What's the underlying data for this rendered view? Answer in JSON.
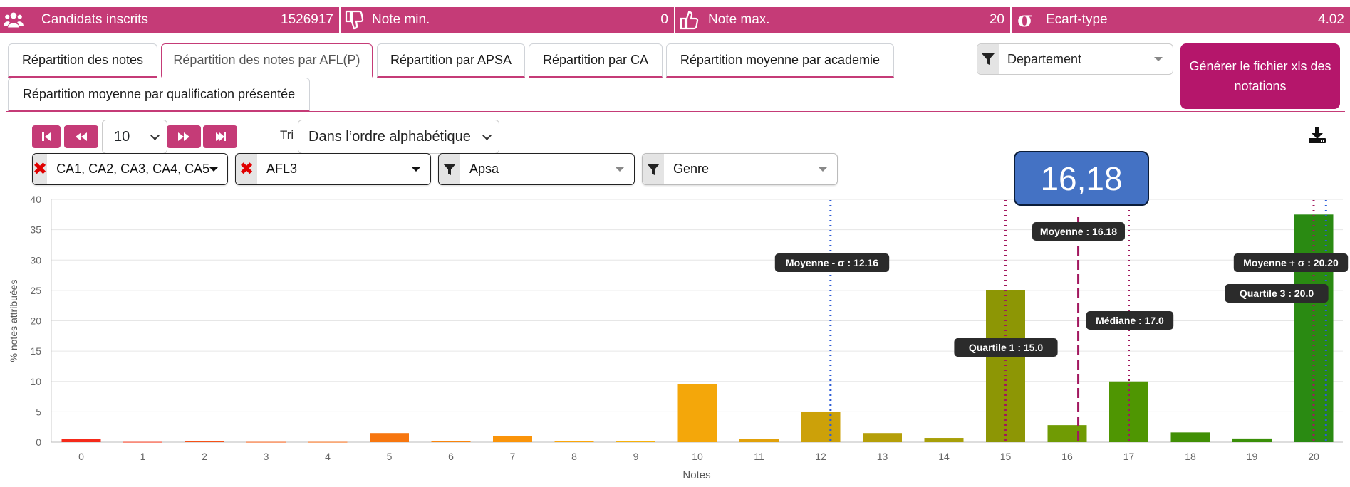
{
  "stats": {
    "candidats_label": "Candidats inscrits",
    "candidats_value": "1526917",
    "note_min_label": "Note min.",
    "note_min_value": "0",
    "note_max_label": "Note max.",
    "note_max_value": "20",
    "ecart_label": "Ecart-type",
    "ecart_value": "4.02",
    "sigma_glyph": "σ"
  },
  "tabs": [
    {
      "label": "Répartition des notes"
    },
    {
      "label": "Répartition des notes par AFL(P)"
    },
    {
      "label": "Répartition par APSA"
    },
    {
      "label": "Répartition par CA"
    },
    {
      "label": "Répartition moyenne par academie"
    },
    {
      "label": "Répartition moyenne par qualification présentée"
    }
  ],
  "active_tab": "Répartition des notes par AFL(P)",
  "departement_filter": "Departement",
  "generate_button": "Générer le fichier xls des notations",
  "pager": {
    "page_size": "10",
    "sort_label": "Tri",
    "sort_value": "Dans l’ordre alphabétique"
  },
  "filters": {
    "ca": "CA1, CA2, CA3, CA4, CA5",
    "afl": "AFL3",
    "apsa": "Apsa",
    "genre": "Genre"
  },
  "highlight_value": "16,18",
  "colors": {
    "accent": "#c53b77",
    "generate": "#b5166b",
    "badge": "#4472c4",
    "sigma_line": "#2b5bd7",
    "quartile_line": "#a2185f"
  },
  "chart_data": {
    "type": "bar",
    "categories": [
      "0",
      "1",
      "2",
      "3",
      "4",
      "5",
      "6",
      "7",
      "8",
      "9",
      "10",
      "11",
      "12",
      "13",
      "14",
      "15",
      "16",
      "17",
      "18",
      "19",
      "20"
    ],
    "values": [
      0.5,
      0.05,
      0.15,
      0.05,
      0.05,
      1.5,
      0.15,
      1.0,
      0.2,
      0.15,
      9.6,
      0.5,
      5.0,
      1.5,
      0.7,
      25.0,
      2.8,
      10.0,
      1.6,
      0.6,
      37.5
    ],
    "bar_colors": [
      "#f52a1a",
      "#f5371a",
      "#f55117",
      "#f55e16",
      "#f56a15",
      "#f7760f",
      "#f9840c",
      "#fa940a",
      "#fba609",
      "#f7b10a",
      "#f4a70a",
      "#e1a10a",
      "#cca109",
      "#b59f09",
      "#a79f09",
      "#8d9605",
      "#709b04",
      "#4f9602",
      "#418f05",
      "#3a8f08",
      "#2a8a12"
    ],
    "xlabel": "Notes",
    "ylabel": "% notes attribuées",
    "ylim": [
      0,
      40
    ],
    "yticks": [
      0,
      5,
      10,
      15,
      20,
      25,
      30,
      35,
      40
    ],
    "grid": true,
    "annotations": [
      {
        "label": "Moyenne - σ : 12.16",
        "x": 12.16,
        "style": "dotted",
        "color": "#2b5bd7"
      },
      {
        "label": "Quartile 1 : 15.0",
        "x": 15.0,
        "style": "dotted",
        "color": "#a2185f"
      },
      {
        "label": "Moyenne : 16.18",
        "x": 16.18,
        "style": "dashed",
        "color": "#a2185f"
      },
      {
        "label": "Médiane : 17.0",
        "x": 17.0,
        "style": "dotted",
        "color": "#a2185f"
      },
      {
        "label": "Moyenne + σ : 20.20",
        "x": 20.2,
        "style": "dotted",
        "color": "#2b5bd7"
      },
      {
        "label": "Quartile 3 : 20.0",
        "x": 20.0,
        "style": "dotted",
        "color": "#a2185f"
      }
    ]
  }
}
